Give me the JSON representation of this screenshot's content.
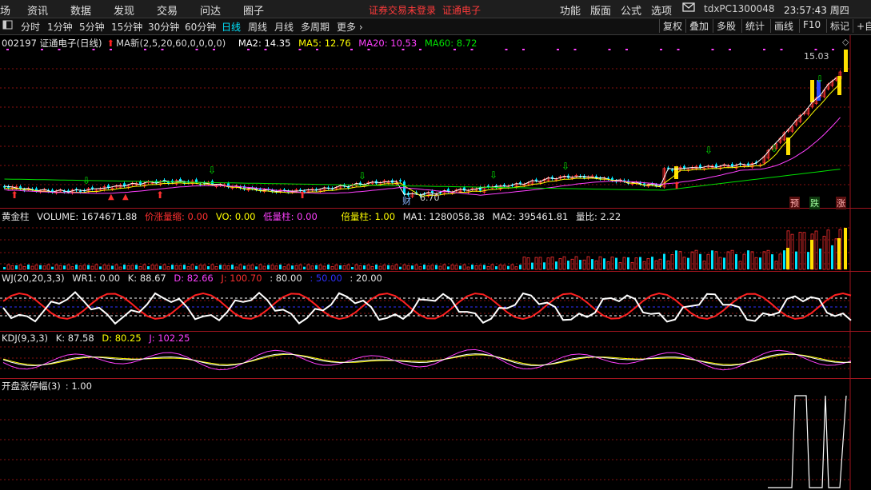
{
  "menu": {
    "items": [
      "场",
      "资讯",
      "数据",
      "发现",
      "交易",
      "问达",
      "圈子"
    ],
    "warning": "证券交易未登录",
    "stock_name": "证通电子",
    "right_items": [
      "功能",
      "版面",
      "公式",
      "选项"
    ],
    "host": "tdxPC1300048",
    "clock": "23:57:43 周四"
  },
  "toolbar": {
    "periods": [
      "分时",
      "1分钟",
      "5分钟",
      "15分钟",
      "30分钟",
      "60分钟",
      "日线",
      "周线",
      "月线",
      "多周期",
      "更多"
    ],
    "active_period": "日线",
    "right_buttons": [
      "复权",
      "叠加",
      "多股",
      "统计",
      "画线",
      "F10",
      "标记",
      "+自"
    ]
  },
  "main_panel": {
    "title": "002197 证通电子(日线)",
    "indicator": "MA新(2,5,20,60,0,0,0,0)",
    "ma2": "MA2: 14.35",
    "ma5": "MA5: 12.76",
    "ma20": "MA20: 10.53",
    "ma60": "MA60: 8.72",
    "high_label": "15.03",
    "low_label": "6.70",
    "cai_label": "财",
    "tags": [
      "预",
      "跌",
      "涨"
    ]
  },
  "volume_panel": {
    "title": "黄金柱",
    "volume": "VOLUME: 1674671.88",
    "jzb": "价涨量缩: 0.00",
    "vo": "VO: 0.00",
    "dlz": "低量柱: 0.00",
    "blz": "倍量柱: 1.00",
    "ma1": "MA1: 1280058.38",
    "ma2": "MA2: 395461.81",
    "lb": "量比: 2.22"
  },
  "wj_panel": {
    "title": "WJ(20,20,3,3)",
    "wr1": "WR1: 0.00",
    "k": "K: 88.67",
    "d": "D: 82.66",
    "j": "J: 100.70",
    "l80": ": 80.00",
    "l50": ": 50.00",
    "l20": ": 20.00"
  },
  "kdj_panel": {
    "title": "KDJ(9,3,3)",
    "k": "K: 87.58",
    "d": "D: 80.25",
    "j": "J: 102.25"
  },
  "zt_panel": {
    "title": "开盘涨停幅(3)",
    "value": ": 1.00"
  },
  "colors": {
    "up": "#ff3030",
    "down": "#00e6ff",
    "ma2": "#ffffff",
    "ma5": "#ffff00",
    "ma20": "#ff40ff",
    "ma60": "#00e000",
    "grid": "#8a1010"
  }
}
